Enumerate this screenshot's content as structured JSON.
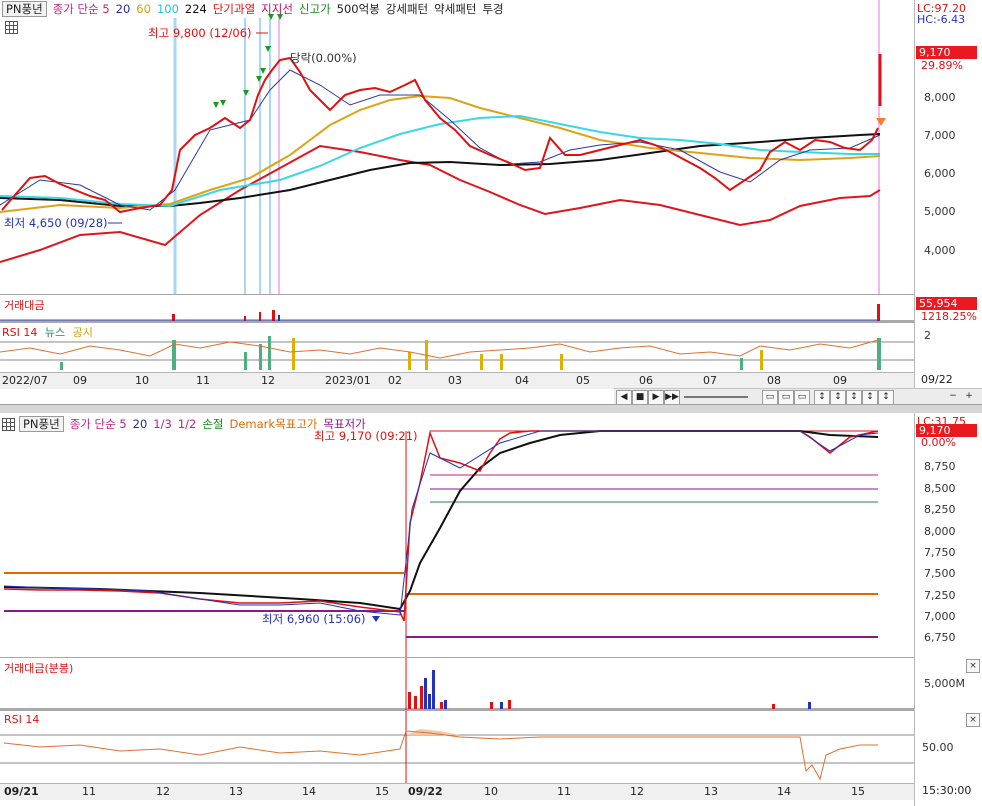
{
  "top_chart": {
    "name": "PN풍년",
    "legend": [
      {
        "text": "종가 단순 5",
        "color": "#c0227a"
      },
      {
        "text": "20",
        "color": "#2a2a9a"
      },
      {
        "text": "60",
        "color": "#d4a20a"
      },
      {
        "text": "100",
        "color": "#1fc5d6"
      },
      {
        "text": "224",
        "color": "#111111"
      },
      {
        "text": "단기과열",
        "color": "#e01010"
      },
      {
        "text": "지지선",
        "color": "#c01060"
      },
      {
        "text": "신고가",
        "color": "#1a8a1a"
      },
      {
        "text": "500억봉",
        "color": "#333333"
      },
      {
        "text": "강세패턴",
        "color": "#333333"
      },
      {
        "text": "약세패턴",
        "color": "#333333"
      },
      {
        "text": "투경",
        "color": "#333333"
      }
    ],
    "lc": "LC:97.20",
    "hc": "HC:-6.43",
    "price_badge": "9,170",
    "pct": "29.89%",
    "price_ticks": [
      "8,000",
      "7,000",
      "6,000",
      "5,000",
      "4,000"
    ],
    "annotation_high": "최고 9,800 (12/06)",
    "annotation_low": "최저 4,650 (09/28)",
    "annotation_suspend": "당락(0.00%)",
    "volume_label": "거래대금",
    "volume_badge": "55,954",
    "volume_pct": "1218.25%",
    "rsi_label": "RSI 14",
    "news_label": "뉴스",
    "notice_label": "공시",
    "rsi_tick": "2",
    "dates": [
      "2022/07",
      "09",
      "10",
      "11",
      "12",
      "2023/01",
      "02",
      "03",
      "04",
      "05",
      "06",
      "07",
      "08",
      "09",
      "09/22"
    ],
    "line_colors": {
      "red": "#e0141c",
      "black": "#111111",
      "yellow": "#e0a215",
      "cyan": "#36d8e8",
      "blue": "#2c3a9e"
    }
  },
  "bottom_chart": {
    "name": "PN풍년",
    "legend": [
      {
        "text": "종가 단순 5",
        "color": "#c0227a"
      },
      {
        "text": "20",
        "color": "#2a2a9a"
      },
      {
        "text": "1/3",
        "color": "#c0227a"
      },
      {
        "text": "1/2",
        "color": "#c0227a"
      },
      {
        "text": "손절",
        "color": "#1a8a1a"
      },
      {
        "text": "Demark목표고가",
        "color": "#e06a00"
      },
      {
        "text": "목표저가",
        "color": "#8a1a8a"
      }
    ],
    "lc": "LC:31.75",
    "price_badge": "9,170",
    "pct": "0.00%",
    "price_ticks": [
      "8,750",
      "8,500",
      "8,250",
      "8,000",
      "7,750",
      "7,500",
      "7,250",
      "7,000",
      "6,750"
    ],
    "annotation_high": "최고 9,170 (09:21)",
    "annotation_low": "최저 6,960 (15:06)",
    "volume_label": "거래대금(분봉)",
    "volume_tick": "5,000M",
    "rsi_label": "RSI 14",
    "rsi_tick": "50.00",
    "time_labels": [
      "09/21",
      "11",
      "12",
      "13",
      "14",
      "15",
      "09/22",
      "10",
      "11",
      "12",
      "13",
      "14",
      "15"
    ],
    "time_end": "15:30:00"
  }
}
